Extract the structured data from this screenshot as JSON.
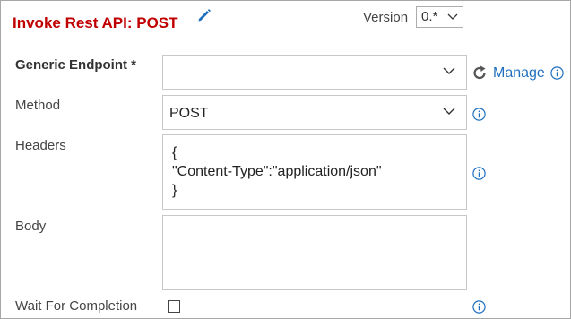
{
  "header": {
    "title": "Invoke Rest API: POST",
    "version_label": "Version",
    "version_value": "0.*"
  },
  "fields": {
    "endpoint": {
      "label": "Generic Endpoint *",
      "value": "",
      "manage_label": "Manage"
    },
    "method": {
      "label": "Method",
      "value": "POST"
    },
    "headers": {
      "label": "Headers",
      "lines": [
        "{",
        "\"Content-Type\":\"application/json\"",
        "}"
      ]
    },
    "body": {
      "label": "Body",
      "value": ""
    },
    "wait": {
      "label": "Wait For Completion",
      "checked": false
    }
  },
  "colors": {
    "title": "#c00000",
    "link": "#1e6fbf",
    "info_icon": "#1e6fbf",
    "pencil_icon": "#1e6fbf"
  },
  "icons": [
    "pencil-icon",
    "chevron-down-icon",
    "refresh-icon",
    "info-icon"
  ]
}
